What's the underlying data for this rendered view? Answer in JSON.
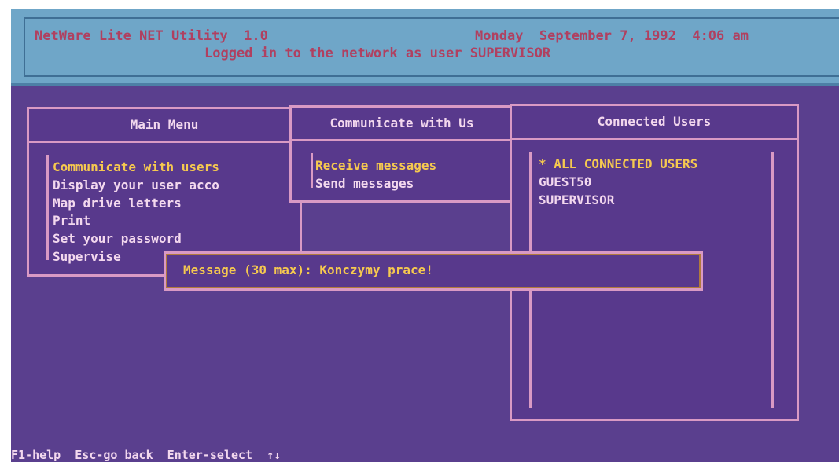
{
  "titlebar": {
    "app_title": "NetWare Lite NET Utility  1.0",
    "datetime": "Monday  September 7, 1992  4:06 am",
    "login_status": "Logged in to the network as user SUPERVISOR"
  },
  "main_menu": {
    "title": "Main Menu",
    "items": [
      "Communicate with users",
      "Display your user acco",
      "Map drive letters",
      "Print",
      "Set your password",
      "Supervise"
    ]
  },
  "communicate_menu": {
    "title": "Communicate with Us",
    "items": [
      "Receive messages",
      "Send messages"
    ]
  },
  "connected_users": {
    "title": "Connected Users",
    "items": [
      "* ALL CONNECTED USERS",
      "GUEST50",
      "SUPERVISOR"
    ]
  },
  "message_prompt": {
    "text": "Message (30 max): Konczymy prace!"
  },
  "statusbar": {
    "text": "F1-help  Esc-go back  Enter-select  ↑↓"
  },
  "colors": {
    "screen_bg": "#5a3f8e",
    "titlebar_bg": "#6fa6c8",
    "border": "#d99ac4",
    "selected": "#f6c94f"
  }
}
